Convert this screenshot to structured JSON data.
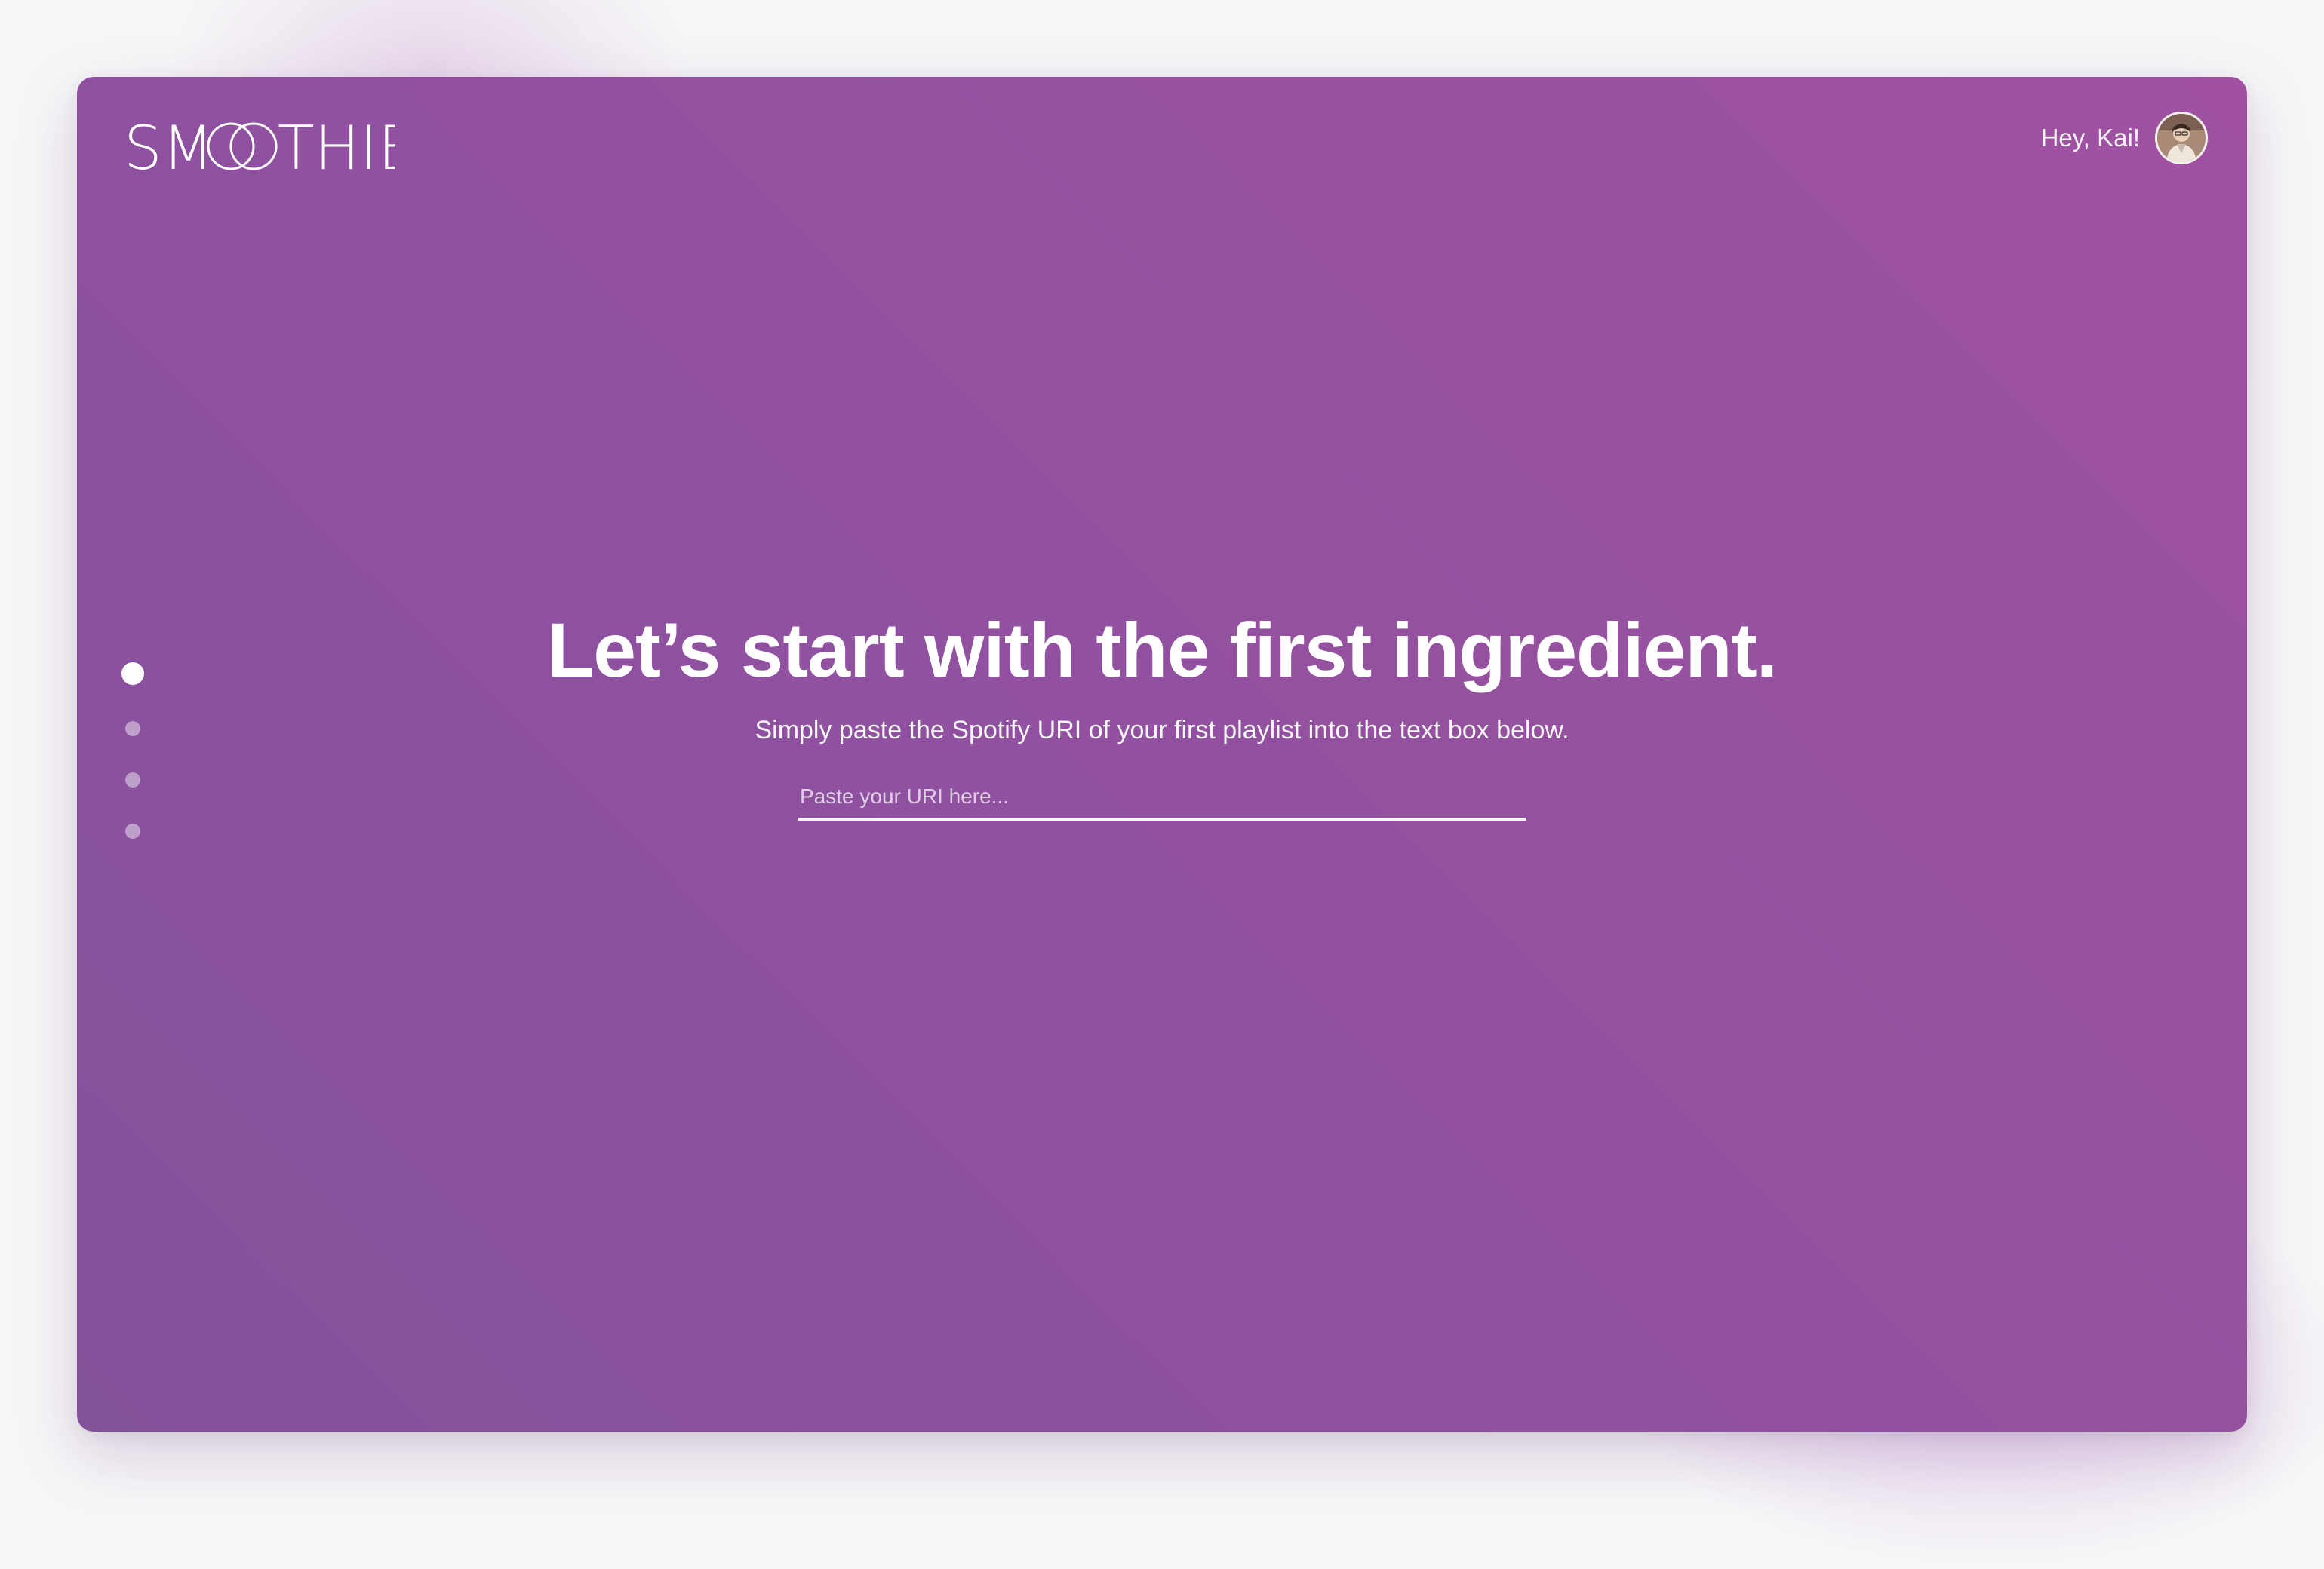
{
  "brand": {
    "logo_text": "SMOOTHIE",
    "logo_icon": "interlocking-rings-logo"
  },
  "header": {
    "greeting": "Hey, Kai!",
    "avatar_icon": "user-avatar-photo"
  },
  "steps": {
    "total": 4,
    "current": 1
  },
  "hero": {
    "headline": "Let’s start with the first ingredient.",
    "subtext": "Simply paste the Spotify URI of your first playlist into the text box below."
  },
  "uri_input": {
    "value": "",
    "placeholder": "Paste your URI here..."
  },
  "colors": {
    "background_start": "#84519b",
    "background_end": "#a052a1",
    "text": "#ffffff"
  }
}
